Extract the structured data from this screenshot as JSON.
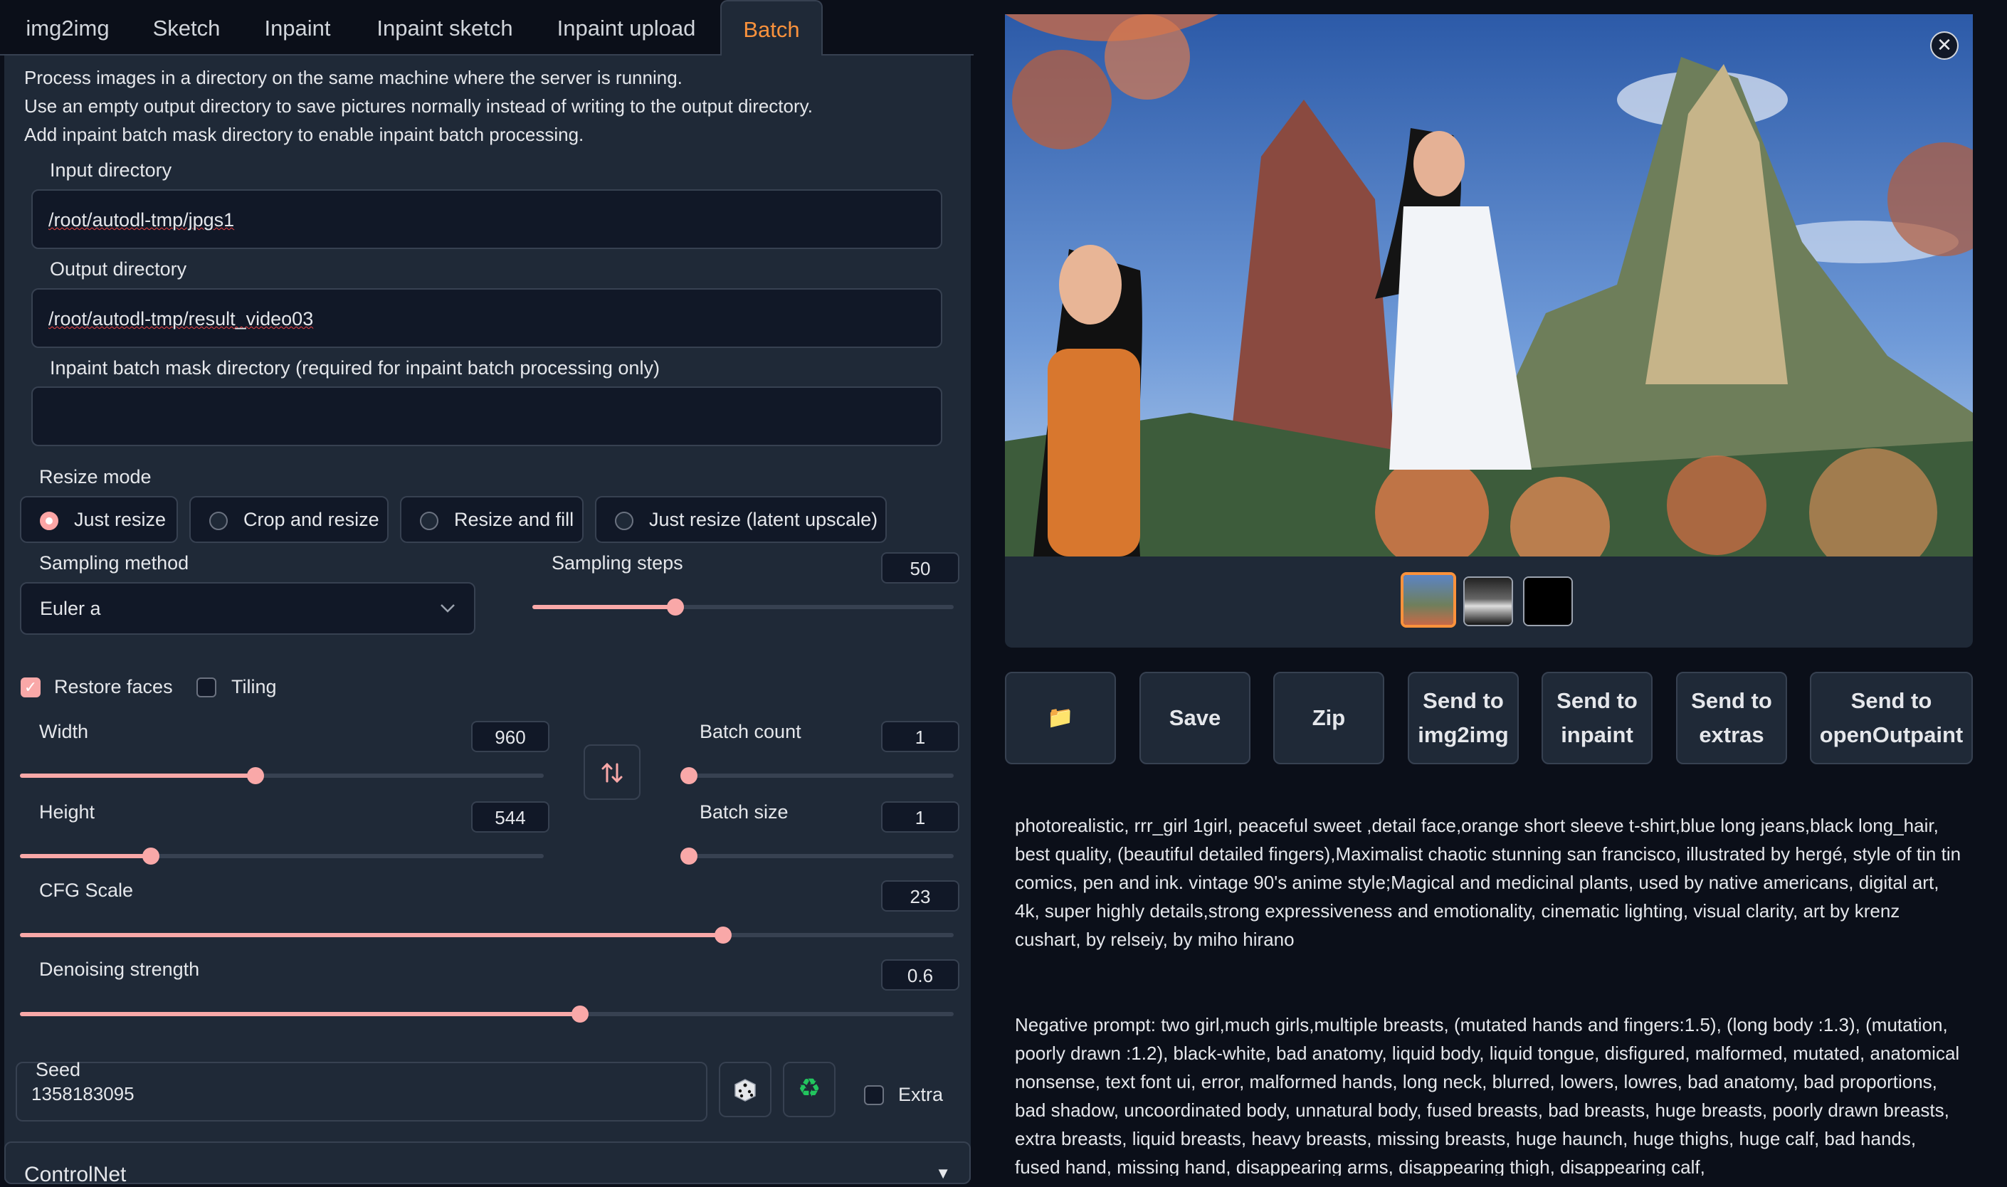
{
  "tabs": [
    {
      "label": "img2img",
      "active": false
    },
    {
      "label": "Sketch",
      "active": false
    },
    {
      "label": "Inpaint",
      "active": false
    },
    {
      "label": "Inpaint sketch",
      "active": false
    },
    {
      "label": "Inpaint upload",
      "active": false
    },
    {
      "label": "Batch",
      "active": true
    }
  ],
  "batch": {
    "info_lines": [
      "Process images in a directory on the same machine where the server is running.",
      "Use an empty output directory to save pictures normally instead of writing to the output directory.",
      "Add inpaint batch mask directory to enable inpaint batch processing."
    ],
    "input_dir_label": "Input directory",
    "input_dir_value": "/root/autodl-tmp/jpgs1",
    "output_dir_label": "Output directory",
    "output_dir_value": "/root/autodl-tmp/result_video03",
    "mask_dir_label": "Inpaint batch mask directory (required for inpaint batch processing only)",
    "mask_dir_value": ""
  },
  "resize_mode": {
    "label": "Resize mode",
    "options": [
      "Just resize",
      "Crop and resize",
      "Resize and fill",
      "Just resize (latent upscale)"
    ],
    "selected": "Just resize"
  },
  "sampling": {
    "method_label": "Sampling method",
    "method_value": "Euler a",
    "steps_label": "Sampling steps",
    "steps_value": "50",
    "steps_fraction": 0.34
  },
  "checks": {
    "restore_faces_label": "Restore faces",
    "restore_faces": true,
    "tiling_label": "Tiling",
    "tiling": false
  },
  "sliders": {
    "width_label": "Width",
    "width_value": "960",
    "width_fraction": 0.45,
    "height_label": "Height",
    "height_value": "544",
    "height_fraction": 0.25,
    "batch_count_label": "Batch count",
    "batch_count_value": "1",
    "batch_count_fraction": 0.0,
    "batch_size_label": "Batch size",
    "batch_size_value": "1",
    "batch_size_fraction": 0.0,
    "cfg_label": "CFG Scale",
    "cfg_value": "23",
    "cfg_fraction": 0.753,
    "denoise_label": "Denoising strength",
    "denoise_value": "0.6",
    "denoise_fraction": 0.6
  },
  "seed": {
    "label": "Seed",
    "value": "1358183095",
    "extra_label": "Extra"
  },
  "controlnet_label": "ControlNet",
  "actions": {
    "folder_icon": "📁",
    "save": "Save",
    "zip": "Zip",
    "send_img2img": [
      "Send to",
      "img2img"
    ],
    "send_inpaint": [
      "Send to",
      "inpaint"
    ],
    "send_extras": [
      "Send to",
      "extras"
    ],
    "send_openoutpaint": [
      "Send to",
      "openOutpaint"
    ]
  },
  "generation": {
    "prompt": "photorealistic, rrr_girl 1girl, peaceful sweet ,detail face,orange short sleeve t-shirt,blue long jeans,black long_hair, best quality, (beautiful detailed fingers),Maximalist chaotic stunning san francisco, illustrated by hergé, style of tin tin comics, pen and ink. vintage 90's anime style;Magical and medicinal plants, used by native americans, digital art, 4k, super highly details,strong expressiveness and emotionality, cinematic lighting, visual clarity, art by krenz cushart, by relseiy, by miho hirano",
    "negative": "Negative prompt: two girl,much girls,multiple breasts, (mutated hands and fingers:1.5), (long body :1.3), (mutation, poorly drawn :1.2), black-white, bad anatomy, liquid body, liquid tongue, disfigured, malformed, mutated, anatomical nonsense, text font ui, error, malformed hands, long neck, blurred, lowers, lowres, bad anatomy, bad proportions, bad shadow, uncoordinated body, unnatural body, fused breasts, bad breasts, huge breasts, poorly drawn breasts, extra breasts, liquid breasts, heavy breasts, missing breasts, huge haunch, huge thighs, huge calf, bad hands, fused hand, missing hand, disappearing arms, disappearing thigh, disappearing calf,"
  },
  "colors": {
    "accent": "#fb923c",
    "slider": "#f9a8a8",
    "panel": "#1f2937",
    "background": "#0b0f19"
  }
}
